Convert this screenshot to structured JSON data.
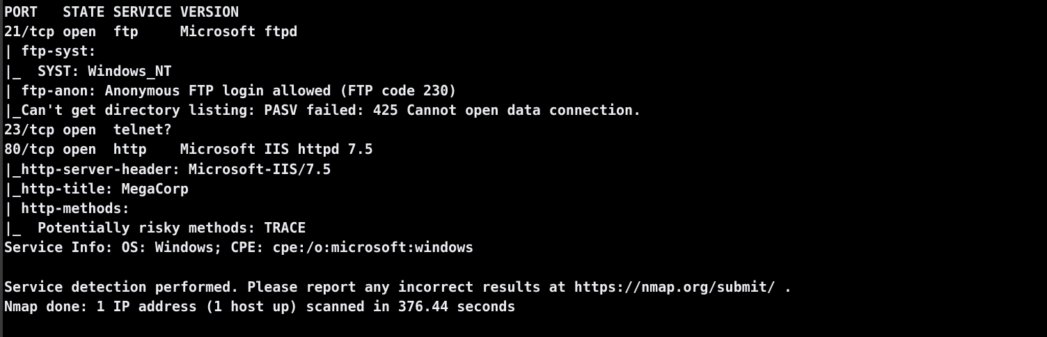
{
  "terminal": {
    "lines": [
      "PORT   STATE SERVICE VERSION",
      "21/tcp open  ftp     Microsoft ftpd",
      "| ftp-syst: ",
      "|_  SYST: Windows_NT",
      "| ftp-anon: Anonymous FTP login allowed (FTP code 230)",
      "|_Can't get directory listing: PASV failed: 425 Cannot open data connection.",
      "23/tcp open  telnet?",
      "80/tcp open  http    Microsoft IIS httpd 7.5",
      "|_http-server-header: Microsoft-IIS/7.5",
      "|_http-title: MegaCorp",
      "| http-methods: ",
      "|_  Potentially risky methods: TRACE",
      "Service Info: OS: Windows; CPE: cpe:/o:microsoft:windows",
      "",
      "Service detection performed. Please report any incorrect results at https://nmap.org/submit/ .",
      "Nmap done: 1 IP address (1 host up) scanned in 376.44 seconds"
    ]
  }
}
